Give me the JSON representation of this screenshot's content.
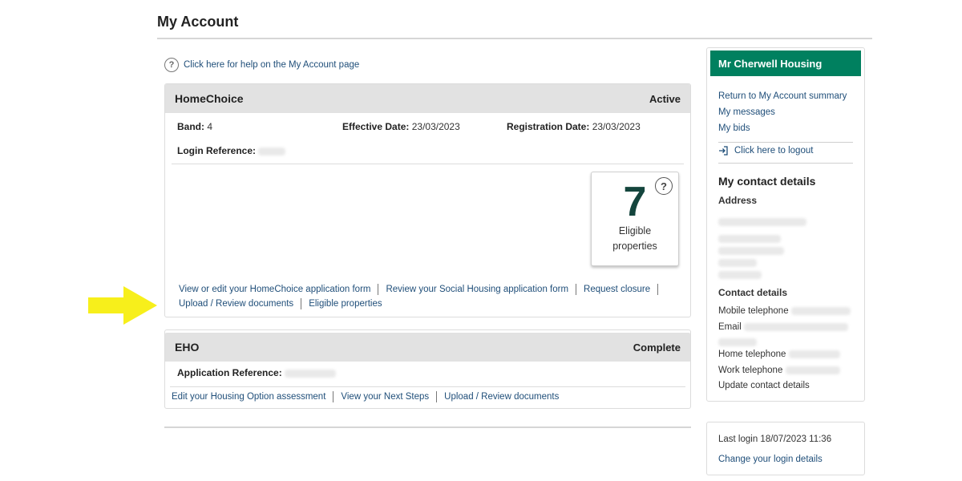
{
  "page": {
    "title": "My Account"
  },
  "help": {
    "icon": "help-circle-icon",
    "text": "Click here for help on the My Account page"
  },
  "homechoice": {
    "title": "HomeChoice",
    "status": "Active",
    "band_label": "Band:",
    "band_value": "4",
    "effective_label": "Effective Date:",
    "effective_value": "23/03/2023",
    "registration_label": "Registration Date:",
    "registration_value": "23/03/2023",
    "login_ref_label": "Login Reference:",
    "eligible": {
      "count": "7",
      "label_line1": "Eligible",
      "label_line2": "properties",
      "help_icon": "help-circle-icon"
    },
    "links": [
      "View or edit your HomeChoice application form",
      "Review your Social Housing application form",
      "Request closure",
      "Upload / Review documents",
      "Eligible properties"
    ]
  },
  "eho": {
    "title": "EHO",
    "status": "Complete",
    "app_ref_label": "Application Reference:",
    "links": [
      "Edit your Housing Option assessment",
      "View your Next Steps",
      "Upload / Review documents"
    ]
  },
  "sidebar": {
    "user_name": "Mr Cherwell Housing",
    "accent_color": "#00805f",
    "links": [
      "Return to My Account summary",
      "My messages",
      "My bids"
    ],
    "logout_icon": "logout-icon",
    "logout_text": "Click here to logout",
    "contact_title": "My contact details",
    "address_label": "Address",
    "contact_label": "Contact details",
    "mobile_label": "Mobile telephone",
    "email_label": "Email",
    "home_label": "Home telephone",
    "work_label": "Work telephone",
    "update_link": "Update contact details"
  },
  "login": {
    "last_login": "Last login 18/07/2023 11:36",
    "change_link": "Change your login details"
  },
  "annotation": {
    "arrow_color": "#f7ef1b",
    "arrow_icon": "right-arrow-icon"
  }
}
